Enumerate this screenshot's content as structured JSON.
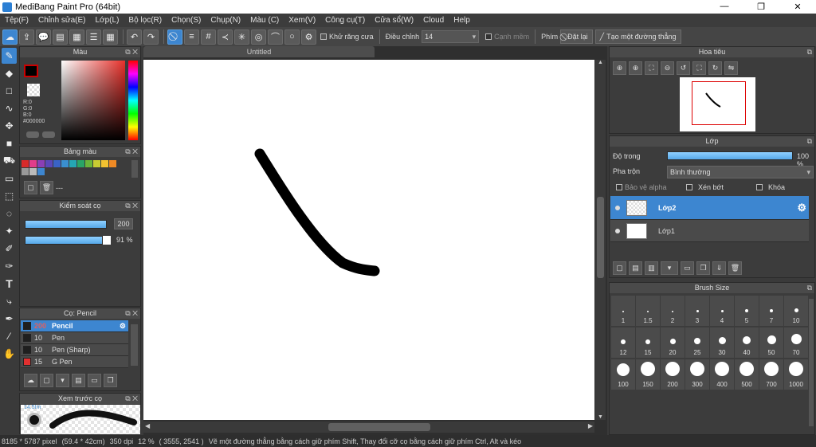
{
  "window": {
    "title": "MediBang Paint Pro (64bit)",
    "minimize": "—",
    "maximize": "❐",
    "close": "✕"
  },
  "menu": [
    "Tệp(F)",
    "Chỉnh sửa(E)",
    "Lớp(L)",
    "Bộ lọc(R)",
    "Chọn(S)",
    "Chụp(N)",
    "Màu (C)",
    "Xem(V)",
    "Công cụ(T)",
    "Cửa sổ(W)",
    "Cloud",
    "Help"
  ],
  "toolbar": {
    "antialias_label": "Khử răng cưa",
    "correction_label": "Điều chỉnh",
    "correction_value": "14",
    "edge_label": "Cạnh mềm",
    "key_label": "Phím",
    "reset_label": "Đặt lại",
    "straight_line_label": "Tạo một đường thẳng"
  },
  "color_panel": {
    "title": "Màu",
    "r": "R:0",
    "g": "G:0",
    "b": "B:0",
    "hex": "#000000"
  },
  "palette_panel": {
    "title": "Bảng màu",
    "dash": "---",
    "colors": [
      "#d92a2a",
      "#e23c8b",
      "#8a3fb5",
      "#5a48b8",
      "#3a63c6",
      "#3a8fd0",
      "#25a6b3",
      "#2aa566",
      "#6bb53a",
      "#c8cc32",
      "#f2c230",
      "#f08a24",
      "#999999",
      "#bbbbbb",
      "#3d86d0"
    ]
  },
  "brush_control": {
    "title": "Kiểm soát cọ",
    "size": "200",
    "opacity": "91 %",
    "size_fill": 0.95,
    "opacity_fill": 0.91
  },
  "brush_panel": {
    "title": "Cọ: Pencil",
    "items": [
      {
        "size": "200",
        "name": "Pencil",
        "color": "#1f1f1f"
      },
      {
        "size": "10",
        "name": "Pen",
        "color": "#1f1f1f"
      },
      {
        "size": "10",
        "name": "Pen (Sharp)",
        "color": "#1f1f1f"
      },
      {
        "size": "15",
        "name": "G Pen",
        "color": "#e03030"
      }
    ]
  },
  "preview_panel": {
    "title": "Xem trước cọ",
    "size_text": "14.5Im"
  },
  "document": {
    "tab_label": "Untitled"
  },
  "navigator_panel": {
    "title": "Hoa tiêu"
  },
  "layer_panel": {
    "title": "Lớp",
    "opacity_label": "Độ trong",
    "opacity_value": "100 %",
    "opacity_fill": 1.0,
    "blend_label": "Pha trộn",
    "blend_value": "Bình thường",
    "protect_alpha": "Bảo vệ alpha",
    "clipping": "Xén bớt",
    "lock": "Khóa",
    "layers": [
      {
        "name": "Lớp2"
      },
      {
        "name": "Lớp1"
      }
    ]
  },
  "brush_size_panel": {
    "title": "Brush Size",
    "sizes": [
      "1",
      "1.5",
      "2",
      "3",
      "4",
      "5",
      "7",
      "10",
      "12",
      "15",
      "20",
      "25",
      "30",
      "40",
      "50",
      "70",
      "100",
      "150",
      "200",
      "300",
      "400",
      "500",
      "700",
      "1000"
    ]
  },
  "status": {
    "dimensions": "8185 * 5787 pixel",
    "physical": "(59.4 * 42cm)",
    "dpi": "350 dpi",
    "zoom": "12 %",
    "coords": "( 3555, 2541 )",
    "hint": "Vẽ một đường thẳng bằng cách giữ phím Shift, Thay đổi cỡ cọ bằng cách giữ phím Ctrl, Alt và kéo"
  }
}
